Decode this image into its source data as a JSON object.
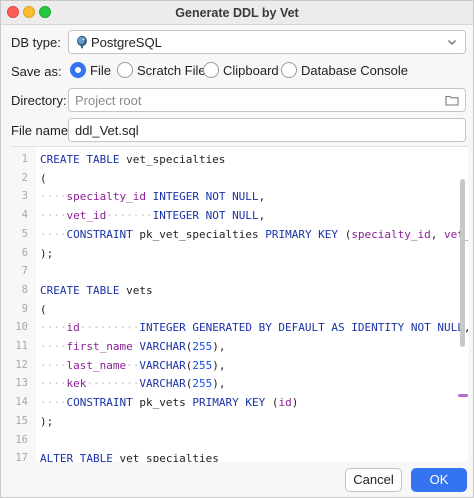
{
  "window": {
    "title": "Generate DDL by Vet"
  },
  "db_type": {
    "label": "DB type:",
    "value": "PostgreSQL",
    "icon": "postgresql-elephant-icon"
  },
  "save_as": {
    "label": "Save as:",
    "options": [
      {
        "label": "File",
        "selected": true
      },
      {
        "label": "Scratch File",
        "selected": false
      },
      {
        "label": "Clipboard",
        "selected": false
      },
      {
        "label": "Database Console",
        "selected": false
      }
    ]
  },
  "directory": {
    "label": "Directory:",
    "placeholder": "Project root",
    "value": ""
  },
  "file_name": {
    "label": "File name:",
    "value": "ddl_Vet.sql"
  },
  "editor": {
    "line_numbers": [
      "1",
      "2",
      "3",
      "4",
      "5",
      "6",
      "7",
      "8",
      "9",
      "10",
      "11",
      "12",
      "13",
      "14",
      "15",
      "16",
      "17"
    ],
    "lines": [
      [
        {
          "t": "kw",
          "v": "CREATE TABLE "
        },
        {
          "t": "plain",
          "v": "vet_specialties"
        }
      ],
      [
        {
          "t": "plain",
          "v": "("
        }
      ],
      [
        {
          "t": "ws",
          "v": "····"
        },
        {
          "t": "id",
          "v": "specialty_id "
        },
        {
          "t": "kw",
          "v": "INTEGER NOT NULL"
        },
        {
          "t": "plain",
          "v": ","
        }
      ],
      [
        {
          "t": "ws",
          "v": "····"
        },
        {
          "t": "id",
          "v": "vet_id"
        },
        {
          "t": "ws",
          "v": "·······"
        },
        {
          "t": "kw",
          "v": "INTEGER NOT NULL"
        },
        {
          "t": "plain",
          "v": ","
        }
      ],
      [
        {
          "t": "ws",
          "v": "····"
        },
        {
          "t": "kw",
          "v": "CONSTRAINT "
        },
        {
          "t": "plain",
          "v": "pk_vet_specialties "
        },
        {
          "t": "kw",
          "v": "PRIMARY KEY "
        },
        {
          "t": "plain",
          "v": "("
        },
        {
          "t": "id",
          "v": "specialty_id"
        },
        {
          "t": "plain",
          "v": ", "
        },
        {
          "t": "id",
          "v": "vet_id"
        },
        {
          "t": "plain",
          "v": ")"
        }
      ],
      [
        {
          "t": "plain",
          "v": ");"
        }
      ],
      [],
      [
        {
          "t": "kw",
          "v": "CREATE TABLE "
        },
        {
          "t": "plain",
          "v": "vets"
        }
      ],
      [
        {
          "t": "plain",
          "v": "("
        }
      ],
      [
        {
          "t": "ws",
          "v": "····"
        },
        {
          "t": "id",
          "v": "id"
        },
        {
          "t": "ws",
          "v": "·········"
        },
        {
          "t": "kw",
          "v": "INTEGER GENERATED BY DEFAULT AS IDENTITY NOT NULL"
        },
        {
          "t": "plain",
          "v": ","
        }
      ],
      [
        {
          "t": "ws",
          "v": "····"
        },
        {
          "t": "id",
          "v": "first_name "
        },
        {
          "t": "kw",
          "v": "VARCHAR"
        },
        {
          "t": "plain",
          "v": "("
        },
        {
          "t": "num",
          "v": "255"
        },
        {
          "t": "plain",
          "v": "),"
        }
      ],
      [
        {
          "t": "ws",
          "v": "····"
        },
        {
          "t": "id",
          "v": "last_name"
        },
        {
          "t": "ws",
          "v": "··"
        },
        {
          "t": "kw",
          "v": "VARCHAR"
        },
        {
          "t": "plain",
          "v": "("
        },
        {
          "t": "num",
          "v": "255"
        },
        {
          "t": "plain",
          "v": "),"
        }
      ],
      [
        {
          "t": "ws",
          "v": "····"
        },
        {
          "t": "id",
          "v": "kek"
        },
        {
          "t": "ws",
          "v": "········"
        },
        {
          "t": "kw",
          "v": "VARCHAR"
        },
        {
          "t": "plain",
          "v": "("
        },
        {
          "t": "num",
          "v": "255"
        },
        {
          "t": "plain",
          "v": "),"
        }
      ],
      [
        {
          "t": "ws",
          "v": "····"
        },
        {
          "t": "kw",
          "v": "CONSTRAINT "
        },
        {
          "t": "plain",
          "v": "pk_vets "
        },
        {
          "t": "kw",
          "v": "PRIMARY KEY "
        },
        {
          "t": "plain",
          "v": "("
        },
        {
          "t": "id",
          "v": "id"
        },
        {
          "t": "plain",
          "v": ")"
        }
      ],
      [
        {
          "t": "plain",
          "v": ");"
        }
      ],
      [],
      [
        {
          "t": "kw",
          "v": "ALTER TABLE "
        },
        {
          "t": "plain",
          "v": "vet_specialties"
        }
      ]
    ]
  },
  "buttons": {
    "cancel": "Cancel",
    "ok": "OK"
  },
  "colors": {
    "accent": "#3574f0",
    "keyword": "#1a32a8",
    "identifier": "#8a1f95",
    "number": "#1750eb"
  }
}
